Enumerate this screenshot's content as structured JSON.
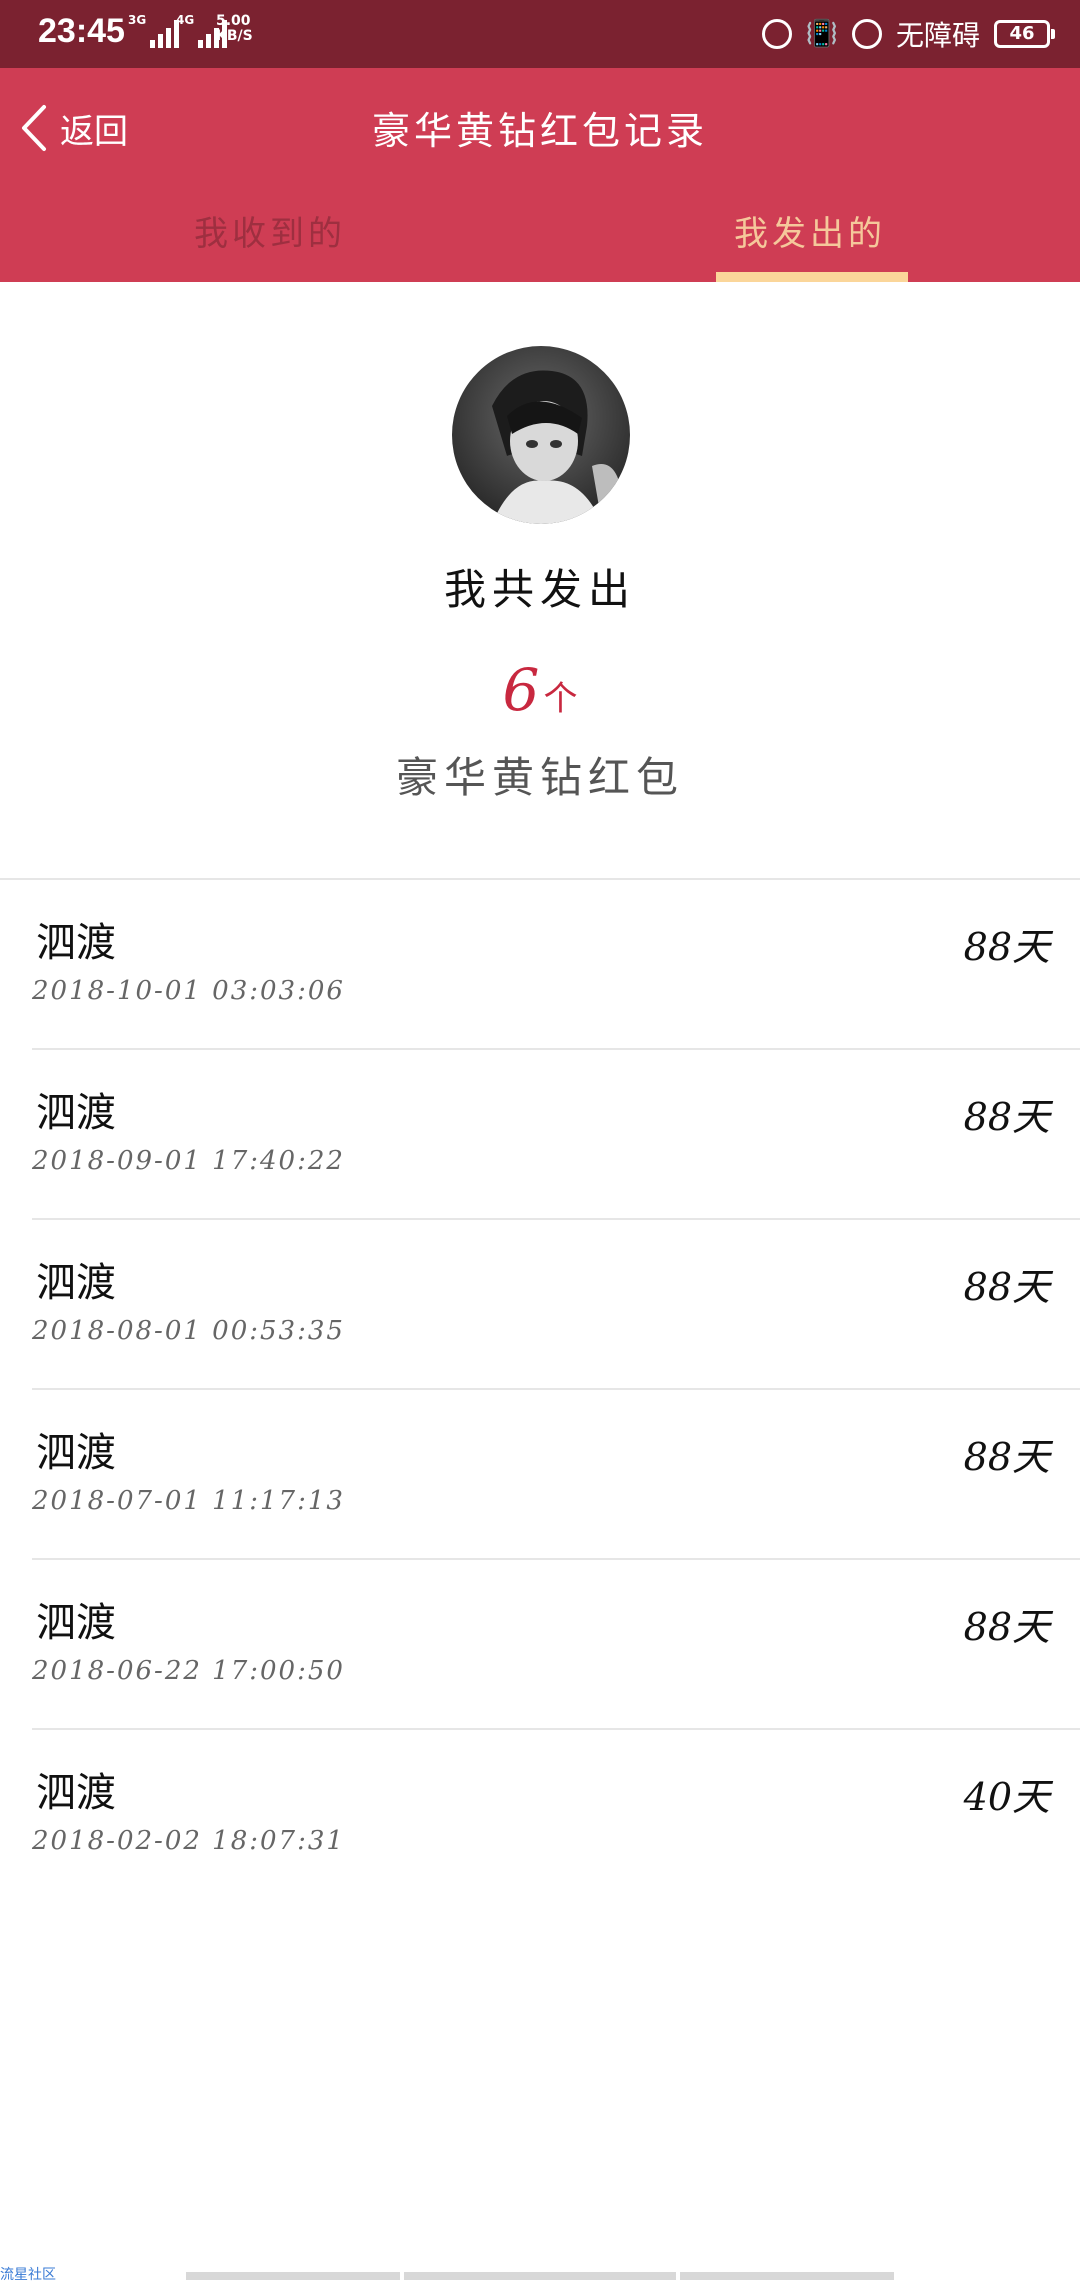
{
  "status_bar": {
    "time": "23:45",
    "net1": "3G",
    "net2": "4G",
    "speed_value": "5.00",
    "speed_unit": "KB/S",
    "accessibility": "无障碍",
    "battery": "46"
  },
  "header": {
    "back_label": "返回",
    "title": "豪华黄钻红包记录",
    "tabs": [
      {
        "label": "我收到的",
        "active": false
      },
      {
        "label": "我发出的",
        "active": true
      }
    ]
  },
  "summary": {
    "title": "我共发出",
    "count": "6",
    "count_unit": "个",
    "subtitle": "豪华黄钻红包"
  },
  "records": [
    {
      "name": "泗渡",
      "time": "2018-10-01 03:03:06",
      "days": "88天"
    },
    {
      "name": "泗渡",
      "time": "2018-09-01 17:40:22",
      "days": "88天"
    },
    {
      "name": "泗渡",
      "time": "2018-08-01 00:53:35",
      "days": "88天"
    },
    {
      "name": "泗渡",
      "time": "2018-07-01 11:17:13",
      "days": "88天"
    },
    {
      "name": "泗渡",
      "time": "2018-06-22 17:00:50",
      "days": "88天"
    },
    {
      "name": "泗渡",
      "time": "2018-02-02 18:07:31",
      "days": "40天"
    }
  ],
  "watermark": "流星社区",
  "colors": {
    "status_bar": "#7b2230",
    "header": "#cf3d54",
    "active_tab": "#f5c89b",
    "count": "#c8283f"
  }
}
